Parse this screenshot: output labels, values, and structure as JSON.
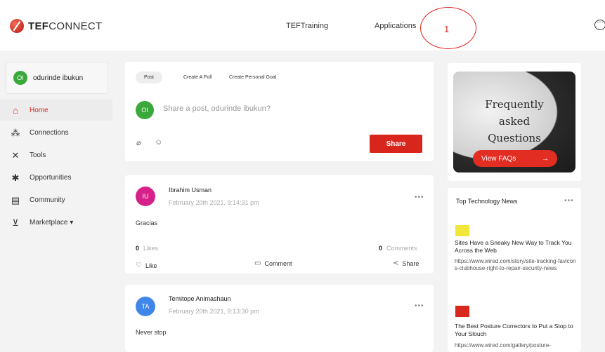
{
  "header": {
    "logo_bold": "TEF",
    "logo_light": "CONNECT",
    "nav": [
      "TEFTraining",
      "Applications"
    ],
    "annotation_number": "1"
  },
  "sidebar": {
    "user": {
      "initials": "OI",
      "name": "odurinde ibukun"
    },
    "items": [
      {
        "label": "Home",
        "icon": "home-icon",
        "glyph": "⌂",
        "active": true
      },
      {
        "label": "Connections",
        "icon": "connections-icon",
        "glyph": "⁂"
      },
      {
        "label": "Tools",
        "icon": "tools-icon",
        "glyph": "✕"
      },
      {
        "label": "Opportunities",
        "icon": "opportunities-icon",
        "glyph": "✱"
      },
      {
        "label": "Community",
        "icon": "community-icon",
        "glyph": "▤"
      },
      {
        "label": "Marketplace ▾",
        "icon": "cart-icon",
        "glyph": "⊻"
      }
    ]
  },
  "composer": {
    "tabs": [
      "Post",
      "Create A Poll",
      "Create Personal Goal"
    ],
    "avatar_initials": "OI",
    "placeholder": "Share a post, odurinde ibukun?",
    "share_label": "Share"
  },
  "posts": [
    {
      "initials": "IU",
      "author": "Ibrahim Usman",
      "time": "February 20th 2021, 9:14:31 pm",
      "text": "Gracias",
      "likes_count": "0",
      "likes_label": "Likes",
      "comments_count": "0",
      "comments_label": "Comments",
      "actions": [
        "Like",
        "Comment",
        "Share"
      ]
    },
    {
      "initials": "TA",
      "author": "Temitope Animashaun",
      "time": "February 20th 2021, 9:13:30 pm",
      "text": "Never stop"
    }
  ],
  "faq": {
    "lines": [
      "Frequently",
      "asked",
      "Questions"
    ],
    "button_label": "View FAQs",
    "arrow": "→"
  },
  "news": {
    "title": "Top Technology News",
    "more": "•••",
    "items": [
      {
        "headline": "Sites Have a Sneaky New Way to Track You Across the Web",
        "url": "https://www.wired.com/story/site-tracking-favicons-clubhouse-right-to-repair-security-news",
        "thumb_color": "#f2e63a"
      },
      {
        "headline": "The Best Posture Correctors to Put a Stop to Your Slouch",
        "url": "https://www.wired.com/gallery/posture-",
        "thumb_color": "#d8281e"
      }
    ]
  },
  "colors": {
    "accent": "#d9261c",
    "active_nav": "#e0231a"
  }
}
